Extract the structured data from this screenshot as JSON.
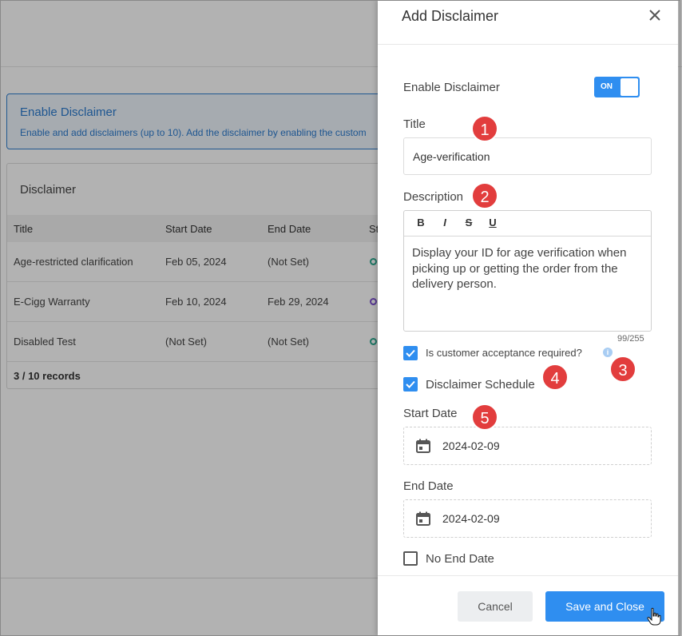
{
  "background": {
    "info_title": "Enable Disclaimer",
    "info_description": "Enable and add disclaimers (up to 10). Add the disclaimer by enabling the custom",
    "table_heading": "Disclaimer",
    "columns": [
      "Title",
      "Start Date",
      "End Date",
      "St"
    ],
    "rows": [
      {
        "title": "Age-restricted clarification",
        "start": "Feb 05, 2024",
        "end": "(Not Set)",
        "status_color": "#2aa88f"
      },
      {
        "title": "E-Cigg Warranty",
        "start": "Feb 10, 2024",
        "end": "Feb 29, 2024",
        "status_color": "#7b4fd0"
      },
      {
        "title": "Disabled Test",
        "start": "(Not Set)",
        "end": "(Not Set)",
        "status_color": "#2aa88f"
      }
    ],
    "records": "3 / 10 records"
  },
  "drawer": {
    "title": "Add Disclaimer",
    "close_icon": "close-icon",
    "enable_label": "Enable Disclaimer",
    "enable_toggle": "ON",
    "title_label": "Title",
    "title_value": "Age-verification",
    "description_label": "Description",
    "toolbar": {
      "bold": "B",
      "italic": "I",
      "strike": "S",
      "underline": "U"
    },
    "description_value": "Display your ID for age verification when picking up or getting the order from the delivery person.",
    "char_count": "99/255",
    "acceptance_label": "Is customer acceptance required?",
    "acceptance_checked": true,
    "schedule_label": "Disclaimer Schedule",
    "schedule_checked": true,
    "start_date_label": "Start Date",
    "start_date_value": "2024-02-09",
    "end_date_label": "End Date",
    "end_date_value": "2024-02-09",
    "no_end_date_label": "No End Date",
    "no_end_date_checked": false,
    "cancel_label": "Cancel",
    "save_label": "Save and Close"
  },
  "markers": [
    "1",
    "2",
    "3",
    "4",
    "5"
  ],
  "colors": {
    "accent": "#2f8ef0",
    "marker": "#e23d3d",
    "info_blue": "#2b7bcf"
  }
}
